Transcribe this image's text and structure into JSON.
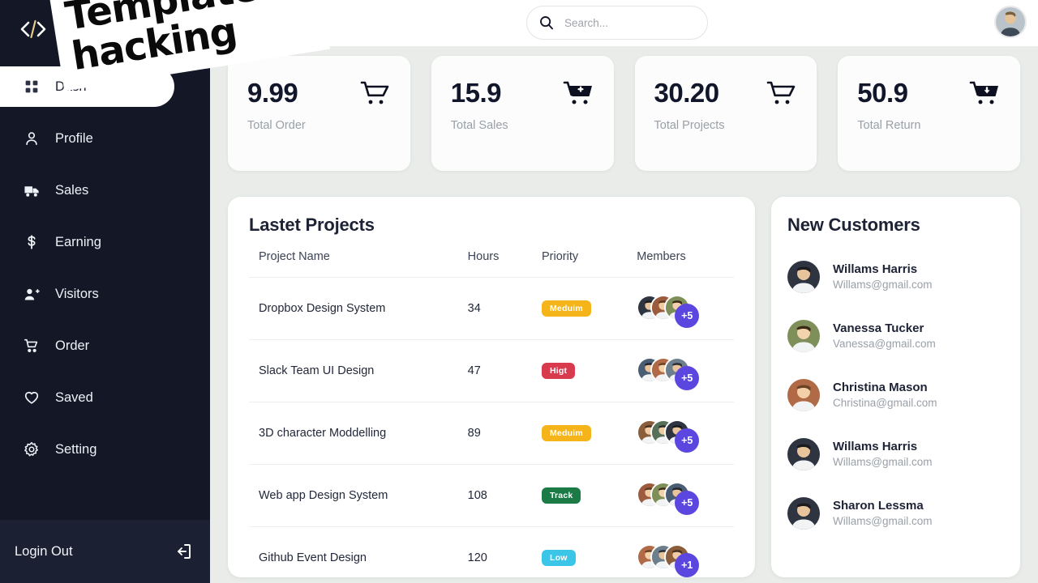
{
  "watermark": {
    "line1": "Template &",
    "line2": "hacking"
  },
  "sidebar": {
    "brand_icon": "code-brackets-icon",
    "items": [
      {
        "label": "Dash",
        "icon": "grid-icon",
        "active": true
      },
      {
        "label": "Profile",
        "icon": "user-icon",
        "active": false
      },
      {
        "label": "Sales",
        "icon": "truck-icon",
        "active": false
      },
      {
        "label": "Earning",
        "icon": "dollar-icon",
        "active": false
      },
      {
        "label": "Visitors",
        "icon": "user-plus-icon",
        "active": false
      },
      {
        "label": "Order",
        "icon": "cart-icon",
        "active": false
      },
      {
        "label": "Saved",
        "icon": "heart-icon",
        "active": false
      },
      {
        "label": "Setting",
        "icon": "gear-icon",
        "active": false
      }
    ],
    "logout": {
      "label": "Login Out",
      "icon": "logout-icon"
    }
  },
  "topbar": {
    "menu_icon": "hamburger-icon",
    "search": {
      "placeholder": "Search...",
      "value": "",
      "icon": "search-icon"
    },
    "avatar": "user-avatar"
  },
  "stats": [
    {
      "value": "9.99",
      "label": "Total Order",
      "icon": "cart-icon"
    },
    {
      "value": "15.9",
      "label": "Total Sales",
      "icon": "cart-plus-icon"
    },
    {
      "value": "30.20",
      "label": "Total Projects",
      "icon": "cart-icon"
    },
    {
      "value": "50.9",
      "label": "Total Return",
      "icon": "cart-download-icon"
    }
  ],
  "projects": {
    "title": "Lastet Projects",
    "columns": [
      "Project Name",
      "Hours",
      "Priority",
      "Members"
    ],
    "rows": [
      {
        "name": "Dropbox Design System",
        "hours": "34",
        "priority": "Meduim",
        "priority_color": "#f4b41a",
        "members": "+5"
      },
      {
        "name": "Slack Team UI Design",
        "hours": "47",
        "priority": "Higt",
        "priority_color": "#d83a4e",
        "members": "+5"
      },
      {
        "name": "3D character Moddelling",
        "hours": "89",
        "priority": "Meduim",
        "priority_color": "#f4b41a",
        "members": "+5"
      },
      {
        "name": "Web app Design System",
        "hours": "108",
        "priority": "Track",
        "priority_color": "#1b7a46",
        "members": "+5"
      },
      {
        "name": "Github Event Design",
        "hours": "120",
        "priority": "Low",
        "priority_color": "#3bc6e8",
        "members": "+1"
      }
    ]
  },
  "customers": {
    "title": "New Customers",
    "rows": [
      {
        "name": "Willams Harris",
        "email": "Willams@gmail.com"
      },
      {
        "name": "Vanessa Tucker",
        "email": "Vanessa@gmail.com"
      },
      {
        "name": "Christina Mason",
        "email": "Christina@gmail.com"
      },
      {
        "name": "Willams Harris",
        "email": "Willams@gmail.com"
      },
      {
        "name": "Sharon Lessma",
        "email": "Willams@gmail.com"
      }
    ]
  },
  "colors": {
    "sidebar_bg": "#131726",
    "page_bg": "#e9ece9",
    "accent_purple": "#5b46e0",
    "card_bg": "#ffffff"
  }
}
